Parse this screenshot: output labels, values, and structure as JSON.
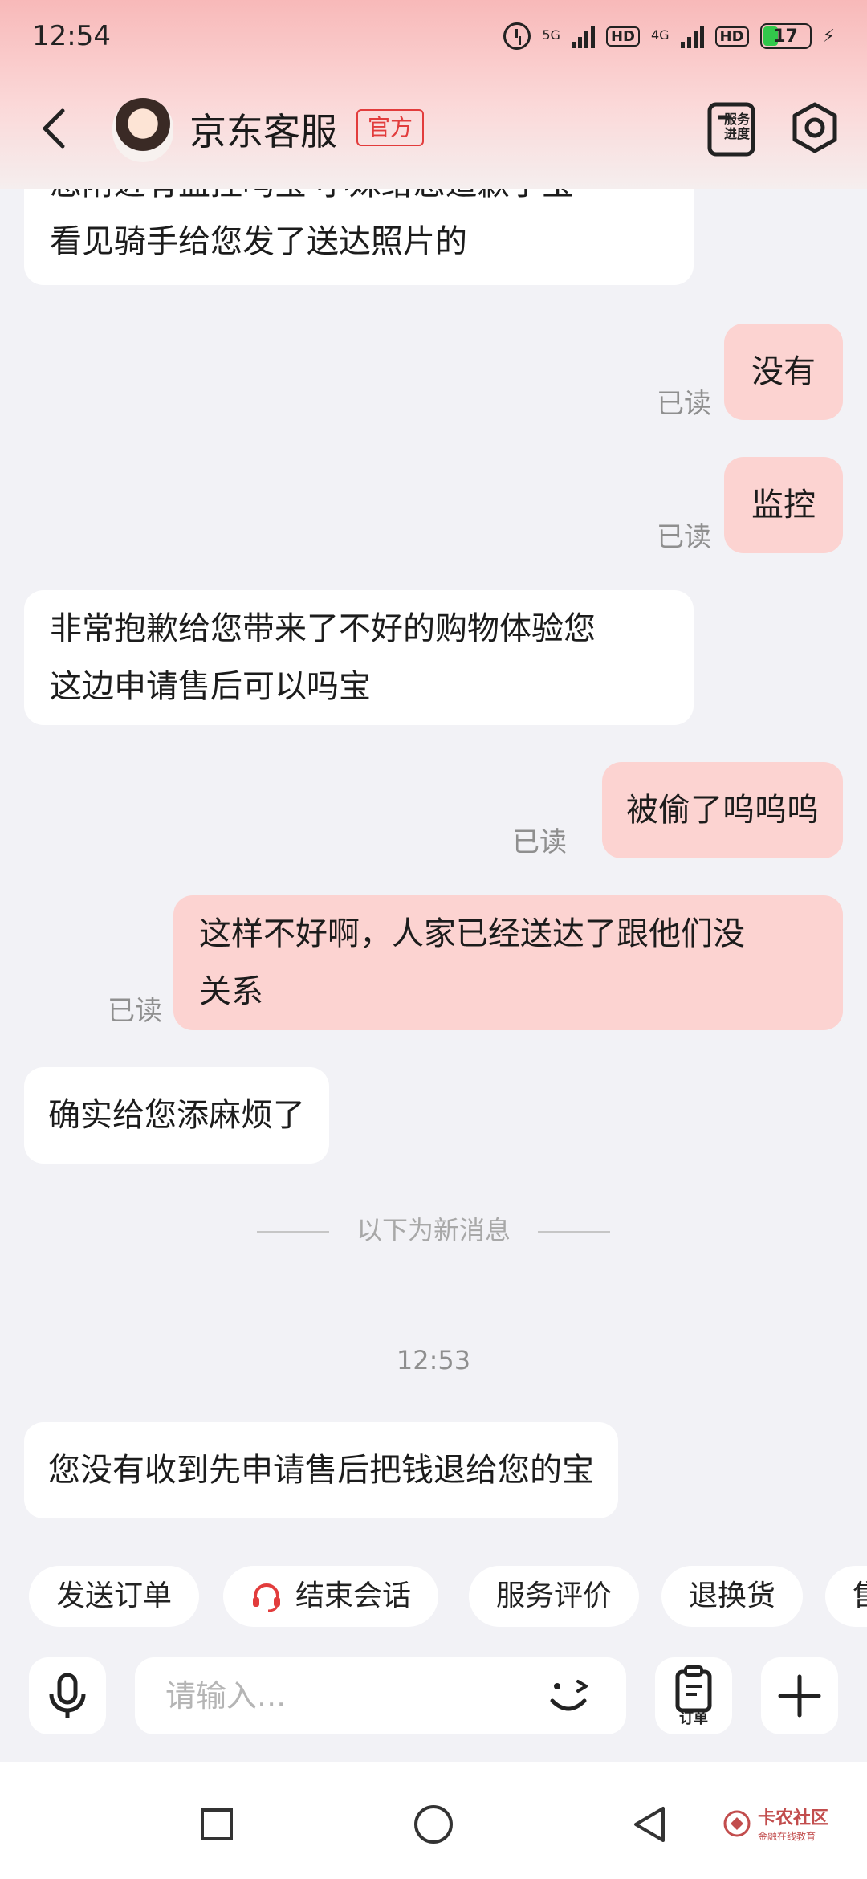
{
  "status_bar": {
    "time": "12:54",
    "network1": "5G",
    "network2": "4G",
    "hd1": "HD",
    "hd2": "HD",
    "battery": "17",
    "battery_color": "#32c84b"
  },
  "header": {
    "title": "京东客服",
    "badge": "官方",
    "service_progress_label": "服务\n进度",
    "accent": "#e23c3c"
  },
  "messages": [
    {
      "side": "in",
      "lines": [
        "您附近有监控吗宝 小妹给您道歉了宝",
        "看见骑手给您发了送达照片的"
      ]
    },
    {
      "side": "out",
      "text": "没有",
      "read": "已读"
    },
    {
      "side": "out",
      "text": "监控",
      "read": "已读"
    },
    {
      "side": "in",
      "lines": [
        "非常抱歉给您带来了不好的购物体验您",
        "这边申请售后可以吗宝"
      ]
    },
    {
      "side": "out",
      "text": "被偷了呜呜呜",
      "read": "已读"
    },
    {
      "side": "out",
      "lines": [
        "这样不好啊，人家已经送达了跟他们没",
        "关系"
      ],
      "read": "已读"
    },
    {
      "side": "in",
      "text": "确实给您添麻烦了"
    },
    {
      "side": "in",
      "text": "您没有收到先申请售后把钱退给您的宝"
    }
  ],
  "divider_text": "以下为新消息",
  "timestamp": "12:53",
  "quick_actions": [
    "发送订单",
    "结束会话",
    "服务评价",
    "退换货",
    "售"
  ],
  "input": {
    "placeholder": "请输入...",
    "order_label": "订单"
  },
  "icons": {
    "back": "back-arrow-icon",
    "settings": "settings-icon",
    "mic": "microphone-icon",
    "emoji": "emoji-icon",
    "plus": "plus-icon",
    "headset": "headset-icon"
  },
  "watermark": {
    "title": "卡农社区",
    "subtitle": "金融在线教育"
  }
}
